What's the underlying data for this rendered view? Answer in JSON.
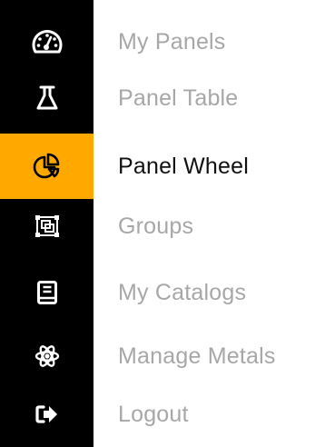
{
  "colors": {
    "sidebar_bg": "#000000",
    "active_bg": "#ffa800",
    "icon": "#ffffff",
    "active_icon": "#000000",
    "label_inactive": "#a7a7a7",
    "label_active": "#111111"
  },
  "nav": {
    "active_index": 2,
    "items": [
      {
        "label": "My Panels",
        "icon": "dashboard-gauge-icon"
      },
      {
        "label": "Panel Table",
        "icon": "flask-icon"
      },
      {
        "label": "Panel Wheel",
        "icon": "pie-chart-icon"
      },
      {
        "label": "Groups",
        "icon": "object-group-icon"
      },
      {
        "label": "My Catalogs",
        "icon": "catalog-book-icon"
      },
      {
        "label": "Manage Metals",
        "icon": "atom-icon"
      },
      {
        "label": "Logout",
        "icon": "logout-icon"
      }
    ]
  }
}
